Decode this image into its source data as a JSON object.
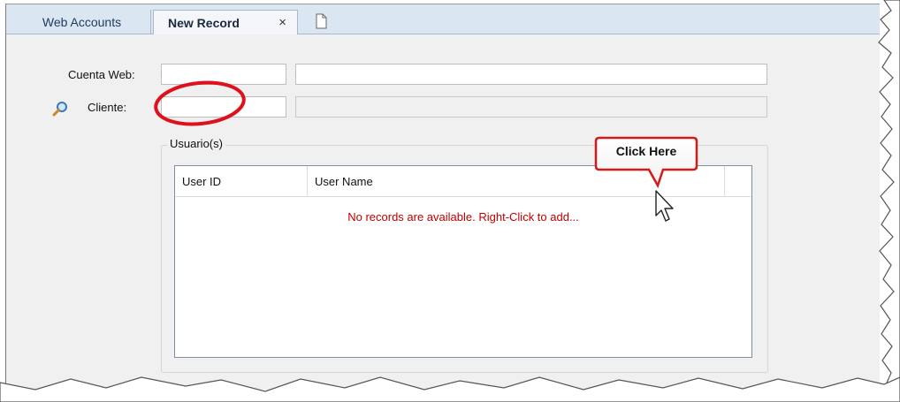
{
  "tabs": [
    {
      "label": "Web Accounts",
      "active": false
    },
    {
      "label": "New Record",
      "active": true,
      "close_glyph": "×"
    }
  ],
  "new_tab_icon": "new-document-icon",
  "form": {
    "cuenta_web_label": "Cuenta Web:",
    "cliente_label": "Cliente:",
    "cuenta_web_code": "",
    "cuenta_web_name": "",
    "cliente_code": "",
    "cliente_name": "",
    "lookup_icon": "magnifier-icon"
  },
  "users_group": {
    "title": "Usuario(s)",
    "columns": [
      "User ID",
      "User Name"
    ],
    "rows": [],
    "empty_message": "No records are available. Right-Click to add..."
  },
  "annotation": {
    "callout_text": "Click Here",
    "highlight_color": "#e0101a"
  },
  "colors": {
    "tabstrip": "#dbe6f3",
    "empty_message": "#c00000",
    "panel": "#f0f0f0"
  }
}
